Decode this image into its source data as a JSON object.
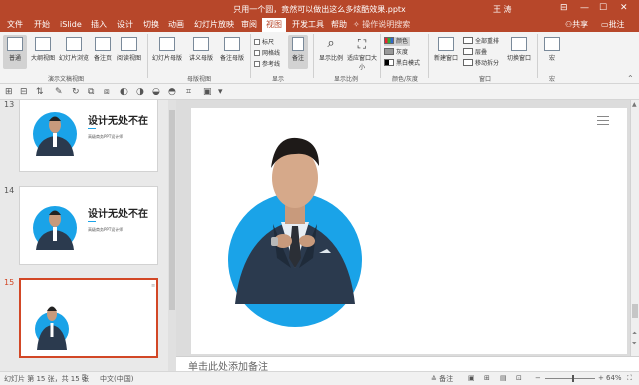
{
  "window": {
    "title": "只用一个圆，竟然可以做出这么多炫酷效果.pptx",
    "user": "王 涛",
    "controls": [
      "⊟",
      "—",
      "☐",
      "✕"
    ]
  },
  "tabs": [
    {
      "label": "文件"
    },
    {
      "label": "开始"
    },
    {
      "label": "iSlide"
    },
    {
      "label": "插入"
    },
    {
      "label": "设计"
    },
    {
      "label": "切换"
    },
    {
      "label": "动画"
    },
    {
      "label": "幻灯片放映"
    },
    {
      "label": "审阅"
    },
    {
      "label": "视图",
      "active": true
    },
    {
      "label": "开发工具"
    },
    {
      "label": "帮助"
    }
  ],
  "tell_me": "操作说明搜索",
  "share": "共享",
  "comments": "批注",
  "ribbon": {
    "presentation_views": {
      "label": "演示文稿视图",
      "buttons": [
        "普通",
        "大纲视图",
        "幻灯片浏览",
        "备注页",
        "阅读视图"
      ]
    },
    "master_views": {
      "label": "母版视图",
      "buttons": [
        "幻灯片母版",
        "讲义母版",
        "备注母版"
      ]
    },
    "show": {
      "label": "显示",
      "checkboxes": [
        "标尺",
        "网格线",
        "参考线"
      ],
      "notes_button": "备注"
    },
    "zoom": {
      "label": "显示比例",
      "buttons": [
        "显示比例",
        "适应窗口大小"
      ]
    },
    "color": {
      "label": "颜色/灰度",
      "options": [
        "颜色",
        "灰度",
        "黑白模式"
      ]
    },
    "window": {
      "label": "窗口",
      "new_window": "新建窗口",
      "options": [
        "全部重排",
        "层叠",
        "移动拆分"
      ],
      "switch": "切换窗口"
    },
    "macros": {
      "label": "宏",
      "button": "宏"
    }
  },
  "slides": [
    {
      "number": "13",
      "title": "设计无处不在",
      "subtitle": "高级商务PPT设计师"
    },
    {
      "number": "14",
      "title": "设计无处不在",
      "subtitle": "高级商务PPT设计师"
    },
    {
      "number": "15",
      "title": "",
      "subtitle": "",
      "active": true
    }
  ],
  "notes_placeholder": "单击此处添加备注",
  "status": {
    "slide_info": "幻灯片 第 15 张，共 15 张",
    "language": "中文(中国)",
    "notes_label": "备注",
    "zoom": "64%"
  },
  "colors": {
    "accent": "#b7472a",
    "active_tab_text": "#b7472a",
    "selected_slide": "#d24726",
    "circle": "#1aa3e8",
    "suit": "#2b3a4e"
  }
}
